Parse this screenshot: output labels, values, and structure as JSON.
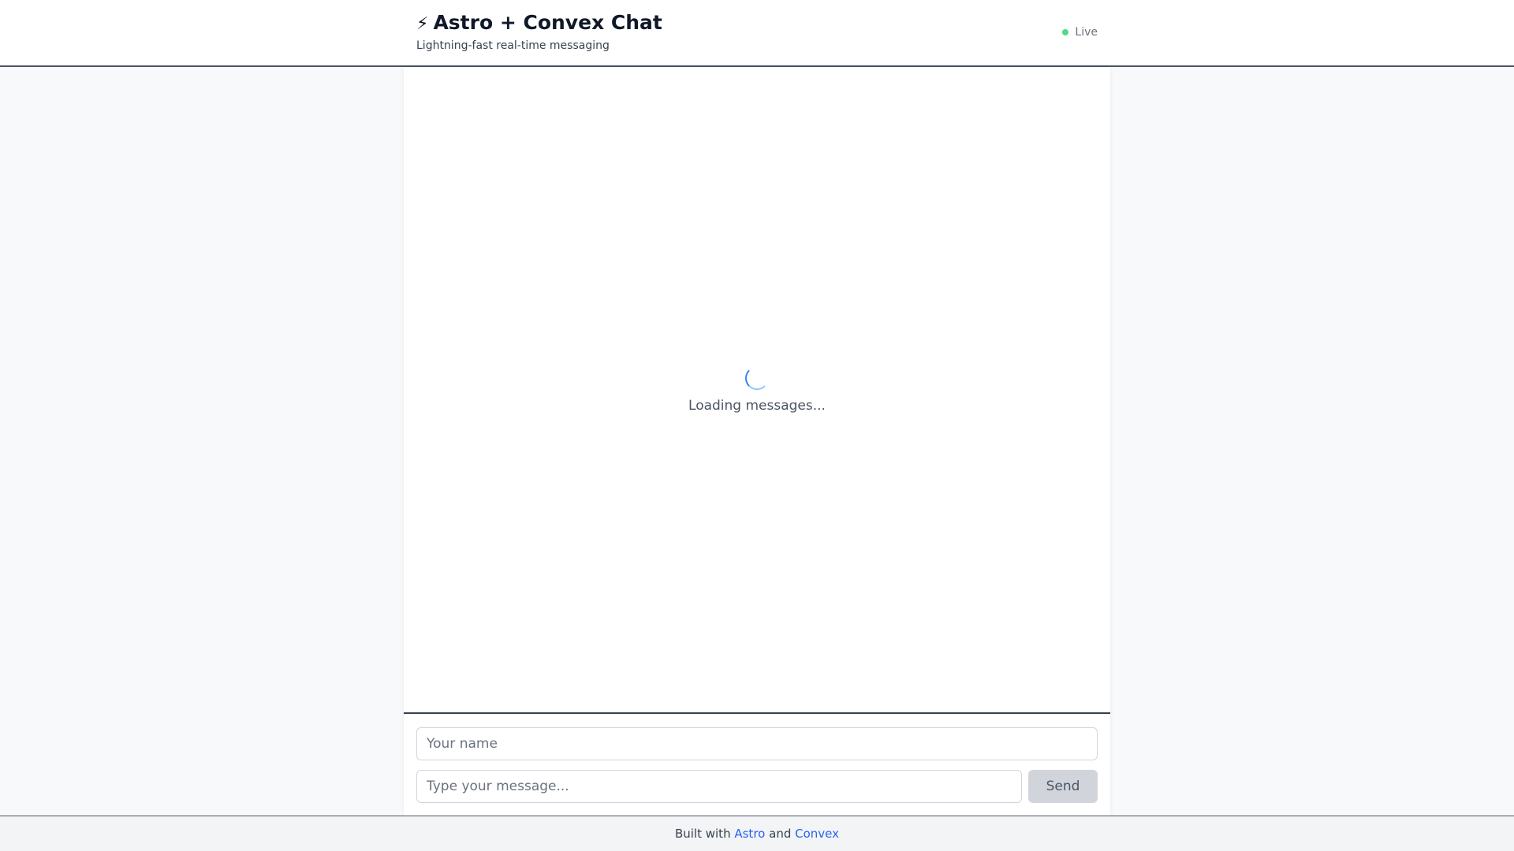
{
  "header": {
    "title": "Astro + Convex Chat",
    "bolt_icon": "⚡",
    "subtitle": "Lightning-fast real-time messaging",
    "status": "Live",
    "status_color": "#4ade80"
  },
  "chat": {
    "loading_text": "Loading messages..."
  },
  "form": {
    "name_placeholder": "Your name",
    "name_value": "",
    "message_placeholder": "Type your message...",
    "message_value": "",
    "send_label": "Send"
  },
  "footer": {
    "prefix": "Built with",
    "link1": "Astro",
    "conjunction": "and",
    "link2": "Convex",
    "link_color": "#2563eb"
  }
}
